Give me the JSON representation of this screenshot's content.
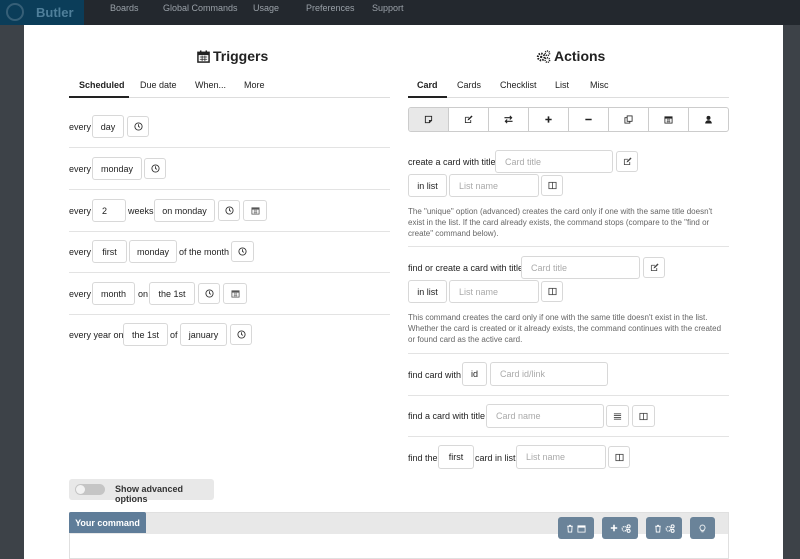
{
  "app": {
    "name": "Butler"
  },
  "nav": [
    "Boards",
    "Global Commands",
    "Usage",
    "Preferences",
    "Support"
  ],
  "triggers": {
    "title": "Triggers",
    "tabs": [
      "Scheduled",
      "Due date",
      "When...",
      "More"
    ],
    "rows": [
      {
        "every": "every",
        "unit": "day"
      },
      {
        "every": "every",
        "day": "monday"
      },
      {
        "every": "every",
        "count": "2",
        "weeks": "weeks",
        "on": "on monday"
      },
      {
        "every": "every",
        "ordinal": "first",
        "day": "monday",
        "suffix": "of the month"
      },
      {
        "every": "every",
        "unit": "month",
        "on": "on",
        "date": "the 1st"
      },
      {
        "every": "every year on",
        "date": "the 1st",
        "of": "of",
        "month": "january"
      }
    ]
  },
  "actions": {
    "title": "Actions",
    "tabs": [
      "Card",
      "Cards",
      "Checklist",
      "List",
      "Misc"
    ],
    "toolbar_icons": [
      "sticky-note-icon",
      "edit-icon",
      "exchange-icon",
      "plus-icon",
      "minus-icon",
      "copy-icon",
      "calendar-icon",
      "user-icon"
    ],
    "create_card": {
      "label": "create a card with title",
      "title_placeholder": "Card title",
      "in_list": "in list",
      "list_placeholder": "List name",
      "note": "The \"unique\" option (advanced) creates the card only if one with the same title doesn't exist in the list. If the card already exists, the command stops (compare to the \"find or create\" command below)."
    },
    "find_or_create": {
      "label": "find or create a card with title",
      "title_placeholder": "Card title",
      "in_list": "in list",
      "list_placeholder": "List name",
      "note": "This command creates the card only if one with the same title doesn't exist in the list. Whether the card is created or it already exists, the command continues with the created or found card as the active card."
    },
    "find_card_with": {
      "label": "find card with",
      "id": "id",
      "placeholder": "Card id/link"
    },
    "find_card_title": {
      "label": "find a card with title",
      "placeholder": "Card name"
    },
    "find_the": {
      "label": "find the",
      "ordinal": "first",
      "mid": "card in list",
      "placeholder": "List name"
    }
  },
  "advanced": {
    "label": "Show advanced options",
    "enabled": false
  },
  "command": {
    "label": "Your command"
  }
}
